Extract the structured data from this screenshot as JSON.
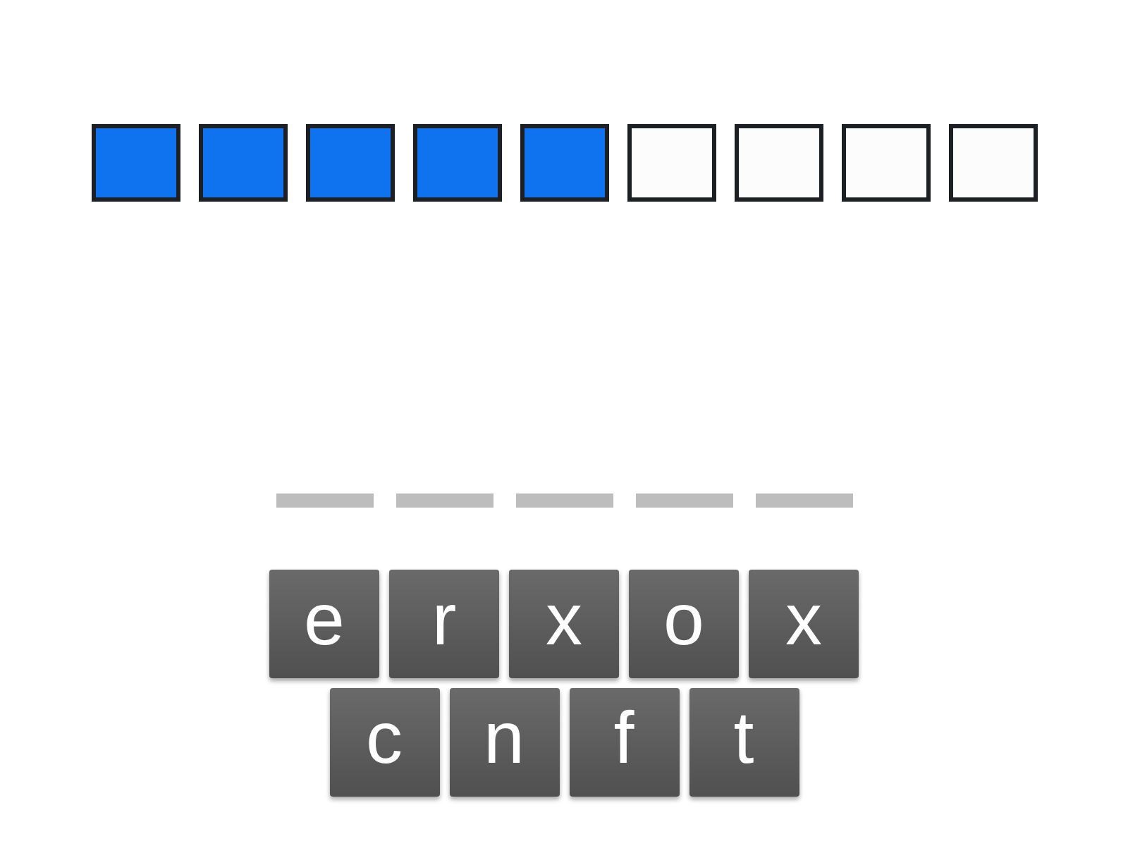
{
  "progress": [
    {
      "done": true
    },
    {
      "done": true
    },
    {
      "done": true
    },
    {
      "done": true
    },
    {
      "done": true
    },
    {
      "done": false
    },
    {
      "done": false
    },
    {
      "done": false
    },
    {
      "done": false
    }
  ],
  "answer_slots": [
    {
      "filled": false
    },
    {
      "filled": false
    },
    {
      "filled": false
    },
    {
      "filled": false
    },
    {
      "filled": false
    }
  ],
  "tile_rows": [
    [
      "e",
      "r",
      "x",
      "o",
      "x"
    ],
    [
      "c",
      "n",
      "f",
      "t"
    ]
  ]
}
